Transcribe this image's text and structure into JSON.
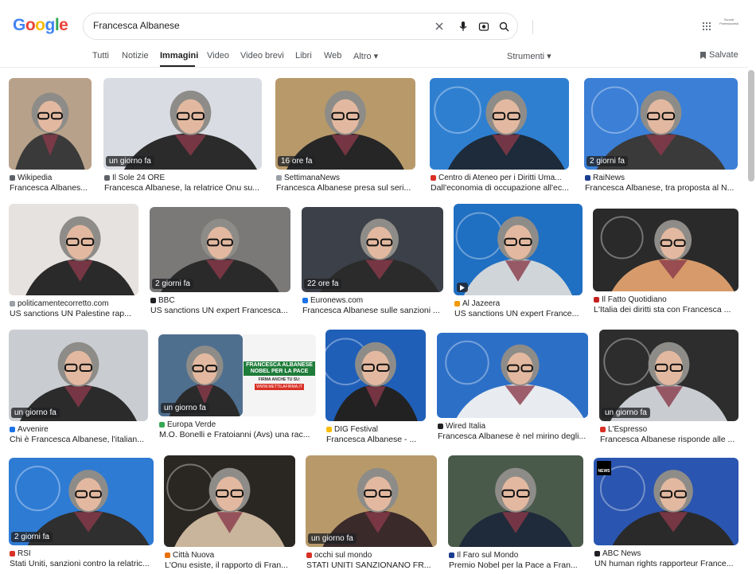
{
  "header": {
    "logo": "Google",
    "query": "Francesca Albanese",
    "account_label": "Scuola Professionisti"
  },
  "tabs": [
    "Tutti",
    "Notizie",
    "Immagini",
    "Video",
    "Video brevi",
    "Libri",
    "Web",
    "Altro ▾"
  ],
  "tools_label": "Strumenti ▾",
  "saved_label": "Salvate",
  "results": [
    {
      "source": "Wikipedia",
      "title": "Francesca Albanes...",
      "badge": "",
      "fav_color": "#5f6368"
    },
    {
      "source": "Il Sole 24 ORE",
      "title": "Francesca Albanese, la relatrice Onu su...",
      "badge": "un giorno fa",
      "fav_color": "#5f6368"
    },
    {
      "source": "SettimanaNews",
      "title": "Francesca Albanese presa sul seri...",
      "badge": "16 ore fa",
      "fav_color": "#9aa0a6"
    },
    {
      "source": "Centro di Ateneo per i Diritti Uma...",
      "title": "Dall'economia di occupazione all'ec...",
      "badge": "",
      "fav_color": "#d93025"
    },
    {
      "source": "RaiNews",
      "title": "Francesca Albanese, tra proposta al N...",
      "badge": "2 giorni fa",
      "fav_color": "#1a3d8f"
    },
    {
      "source": "politicamentecorretto.com",
      "title": "US sanctions UN Palestine rap...",
      "badge": "",
      "fav_color": "#9aa0a6"
    },
    {
      "source": "BBC",
      "title": "US sanctions UN expert Francesca...",
      "badge": "2 giorni fa",
      "fav_color": "#202124"
    },
    {
      "source": "Euronews.com",
      "title": "Francesca Albanese sulle sanzioni ...",
      "badge": "22 ore fa",
      "fav_color": "#1a73e8"
    },
    {
      "source": "Al Jazeera",
      "title": "US sanctions UN expert France...",
      "badge": "",
      "fav_color": "#f29900",
      "video": true
    },
    {
      "source": "Il Fatto Quotidiano",
      "title": "L'Italia dei diritti sta con Francesca ...",
      "badge": "",
      "fav_color": "#c5221f"
    },
    {
      "source": "Avvenire",
      "title": "Chi è Francesca Albanese, l'italian...",
      "badge": "un giorno fa",
      "fav_color": "#1a73e8"
    },
    {
      "source": "Europa Verde",
      "title": "M.O. Bonelli e Fratoianni (Avs) una rac...",
      "badge": "un giorno fa",
      "fav_color": "#34a853"
    },
    {
      "source": "DIG Festival",
      "title": "Francesca Albanese - ...",
      "badge": "",
      "fav_color": "#fbbc04"
    },
    {
      "source": "Wired Italia",
      "title": "Francesca Albanese è nel mirino degli...",
      "badge": "",
      "fav_color": "#202124"
    },
    {
      "source": "L'Espresso",
      "title": "Francesca Albanese risponde alle ...",
      "badge": "un giorno fa",
      "fav_color": "#d93025"
    },
    {
      "source": "RSI",
      "title": "Stati Uniti, sanzioni contro la relatric...",
      "badge": "2 giorni fa",
      "fav_color": "#d93025"
    },
    {
      "source": "Città Nuova",
      "title": "L'Onu esiste, il rapporto di Fran...",
      "badge": "",
      "fav_color": "#e8710a"
    },
    {
      "source": "occhi sul mondo",
      "title": "STATI UNITI SANZIONANO FR...",
      "badge": "un giorno fa",
      "fav_color": "#d93025"
    },
    {
      "source": "Il Faro sul Mondo",
      "title": "Premio Nobel per la Pace a Fran...",
      "badge": "",
      "fav_color": "#1a3d8f"
    },
    {
      "source": "ABC News",
      "title": "UN human rights rapporteur France...",
      "badge": "",
      "fav_color": "#202124"
    }
  ],
  "poster_text": {
    "line1": "FRANCESCA ALBANESE",
    "line2": "NOBEL PER LA PACE",
    "line3": "FIRMA ANCHE TU SU:",
    "line4": "WWW.METTILAFIRMA.IT"
  },
  "abc_logo_text": "NEWS"
}
